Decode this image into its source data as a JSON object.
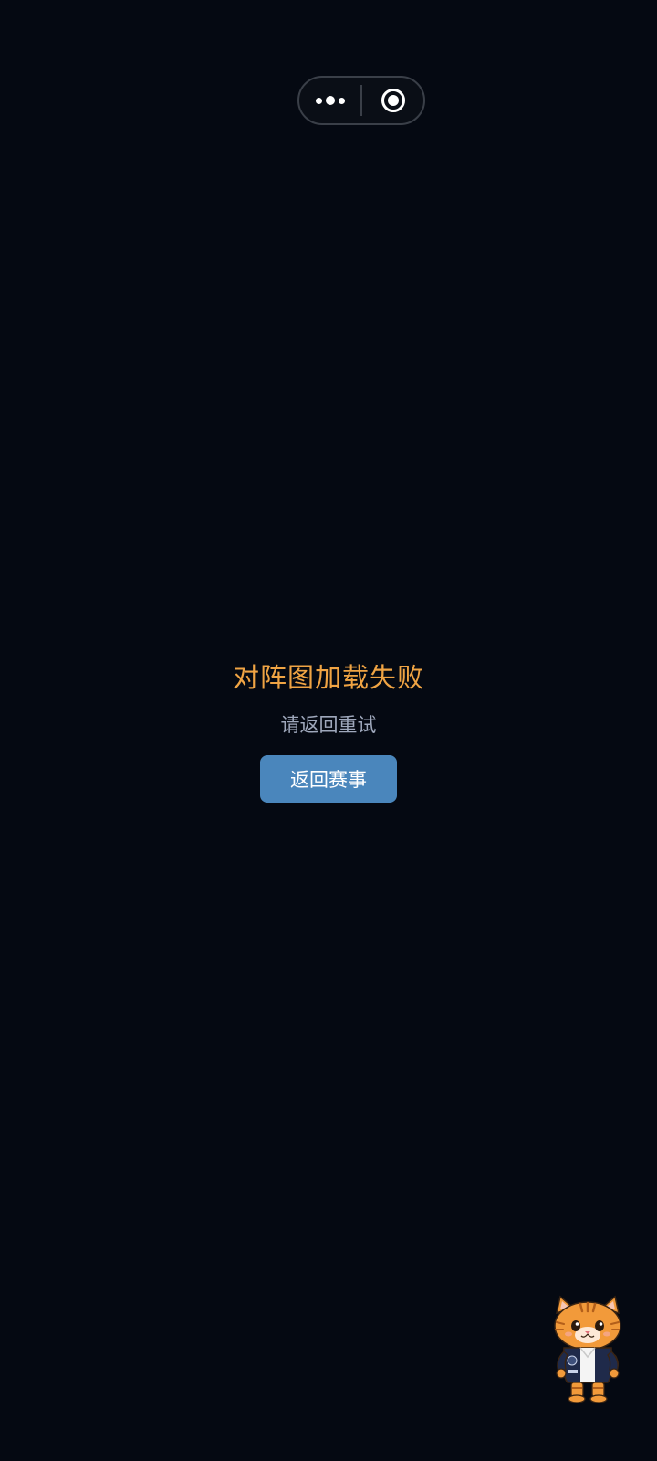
{
  "capsule": {
    "menu_icon": "more-dots-icon",
    "close_icon": "target-circle-icon"
  },
  "error": {
    "title": "对阵图加载失败",
    "subtitle": "请返回重试",
    "button_label": "返回赛事"
  },
  "mascot": {
    "icon": "tabby-cat-mascot"
  },
  "colors": {
    "background": "#050912",
    "title": "#f0a444",
    "subtitle": "#9fa8bc",
    "button": "#4a86bc",
    "button_text": "#ffffff"
  }
}
